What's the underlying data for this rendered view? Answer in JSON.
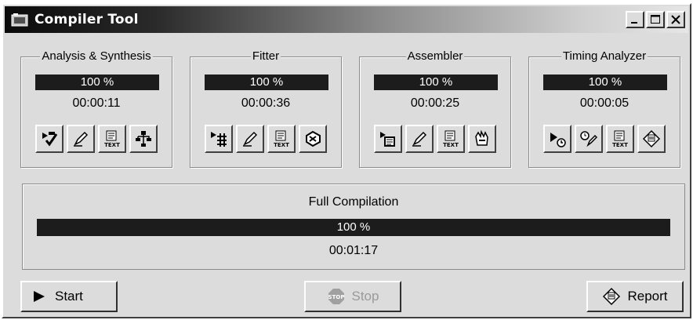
{
  "window": {
    "title": "Compiler Tool"
  },
  "stages": [
    {
      "name": "Analysis & Synthesis",
      "progress_text": "100 %",
      "progress": 100,
      "time": "00:00:11",
      "icons": [
        "start-analysis-icon",
        "edit-settings-icon",
        "text-report-icon",
        "hierarchy-viewer-icon"
      ]
    },
    {
      "name": "Fitter",
      "progress_text": "100 %",
      "progress": 100,
      "time": "00:00:36",
      "icons": [
        "start-fitter-icon",
        "edit-settings-icon",
        "text-report-icon",
        "floorplan-icon"
      ]
    },
    {
      "name": "Assembler",
      "progress_text": "100 %",
      "progress": 100,
      "time": "00:00:25",
      "icons": [
        "start-assembler-icon",
        "edit-settings-icon",
        "text-report-icon",
        "programmer-icon"
      ]
    },
    {
      "name": "Timing Analyzer",
      "progress_text": "100 %",
      "progress": 100,
      "time": "00:00:05",
      "icons": [
        "start-timing-icon",
        "timing-settings-icon",
        "text-report-icon",
        "timing-report-icon"
      ]
    }
  ],
  "full": {
    "title": "Full Compilation",
    "progress_text": "100 %",
    "progress": 100,
    "time": "00:01:17"
  },
  "buttons": {
    "start": "Start",
    "stop": "Stop",
    "stop_icon_text": "STOP",
    "report": "Report"
  },
  "icon_text": "TEXT"
}
